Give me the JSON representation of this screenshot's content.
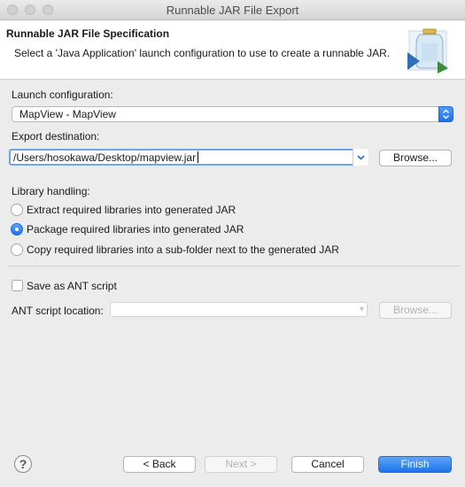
{
  "window": {
    "title": "Runnable JAR File Export"
  },
  "header": {
    "title": "Runnable JAR File Specification",
    "description": "Select a 'Java Application' launch configuration to use to create a runnable JAR.",
    "icon": "jar-export-wizard-icon"
  },
  "launch": {
    "label": "Launch configuration:",
    "value": "MapView - MapView"
  },
  "export": {
    "label": "Export destination:",
    "value": "/Users/hosokawa/Desktop/mapview.jar",
    "browse_label": "Browse..."
  },
  "library": {
    "label": "Library handling:",
    "options": [
      {
        "label": "Extract required libraries into generated JAR",
        "selected": false
      },
      {
        "label": "Package required libraries into generated JAR",
        "selected": true
      },
      {
        "label": "Copy required libraries into a sub-folder next to the generated JAR",
        "selected": false
      }
    ]
  },
  "ant": {
    "save_label": "Save as ANT script",
    "save_checked": false,
    "location_label": "ANT script location:",
    "location_value": "",
    "browse_label": "Browse..."
  },
  "footer": {
    "help_glyph": "?",
    "back_label": "< Back",
    "next_label": "Next >",
    "cancel_label": "Cancel",
    "finish_label": "Finish"
  },
  "colors": {
    "accent": "#1f74ea",
    "focus_ring": "#6ea6ec"
  }
}
